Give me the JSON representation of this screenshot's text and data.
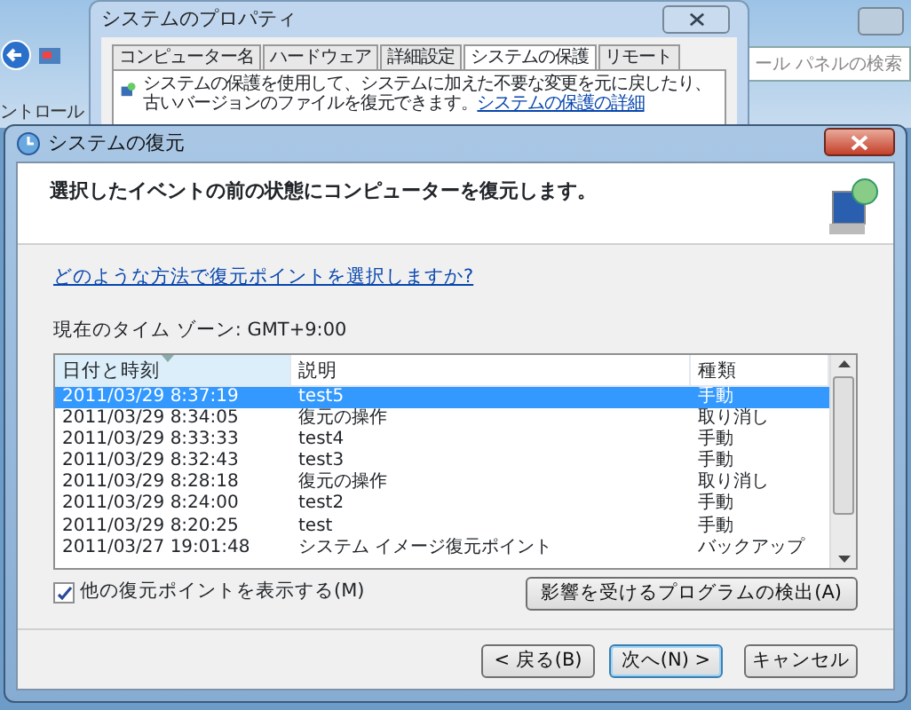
{
  "explorer": {
    "breadcrumb": "ントロール",
    "search_placeholder": "ール パネルの検索"
  },
  "properties_window": {
    "title": "システムのプロパティ",
    "tabs": [
      {
        "label": "コンピューター名",
        "selected": false
      },
      {
        "label": "ハードウェア",
        "selected": false
      },
      {
        "label": "詳細設定",
        "selected": false
      },
      {
        "label": "システムの保護",
        "selected": true
      },
      {
        "label": "リモート",
        "selected": false
      }
    ],
    "description": {
      "text": "システムの保護を使用して、システムに加えた不要な変更を元に戻したり、古いバージョンのファイルを復元できます。",
      "link": "システムの保護の詳細"
    }
  },
  "dialog": {
    "title": "システムの復元",
    "heading": "選択したイベントの前の状態にコンピューターを復元します。",
    "help_link": "どのような方法で復元ポイントを選択しますか?",
    "timezone": "現在のタイム ゾーン: GMT+9:00",
    "table": {
      "columns": [
        {
          "label": "日付と時刻",
          "sorted": true
        },
        {
          "label": "説明",
          "sorted": false
        },
        {
          "label": "種類",
          "sorted": false
        }
      ],
      "rows": [
        {
          "cells": [
            "2011/03/29 8:37:19",
            "test5",
            "手動"
          ],
          "selected": true
        },
        {
          "cells": [
            "2011/03/29 8:34:05",
            "復元の操作",
            "取り消し"
          ],
          "selected": false
        },
        {
          "cells": [
            "2011/03/29 8:33:33",
            "test4",
            "手動"
          ],
          "selected": false
        },
        {
          "cells": [
            "2011/03/29 8:32:43",
            "test3",
            "手動"
          ],
          "selected": false
        },
        {
          "cells": [
            "2011/03/29 8:28:18",
            "復元の操作",
            "取り消し"
          ],
          "selected": false
        },
        {
          "cells": [
            "2011/03/29 8:24:00",
            "test2",
            "手動"
          ],
          "selected": false
        },
        {
          "cells": [
            "2011/03/29 8:20:25",
            "test",
            "手動"
          ],
          "selected": false
        },
        {
          "cells": [
            "2011/03/27 19:01:48",
            "システム イメージ復元ポイント",
            "バックアップ"
          ],
          "selected": false
        }
      ]
    },
    "show_more": {
      "label": "他の復元ポイントを表示する(M)",
      "checked": true
    },
    "detect_button": "影響を受けるプログラムの検出(A)",
    "buttons": [
      {
        "label": "< 戻る(B)",
        "focused": false
      },
      {
        "label": "次へ(N) >",
        "focused": true
      },
      {
        "label": "キャンセル",
        "focused": false
      }
    ]
  }
}
